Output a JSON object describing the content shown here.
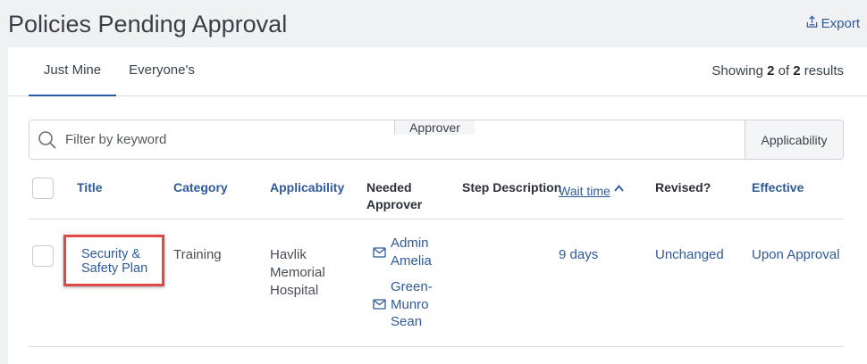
{
  "page": {
    "title": "Policies Pending Approval",
    "export_label": "Export"
  },
  "tabs": [
    {
      "label": "Just Mine",
      "active": true
    },
    {
      "label": "Everyone's",
      "active": false
    }
  ],
  "results": {
    "prefix": "Showing ",
    "shown": "2",
    "middle": " of ",
    "total": "2",
    "suffix": " results"
  },
  "filter": {
    "placeholder": "Filter by keyword",
    "value": "",
    "approver_label": "Approver",
    "applicability_label": "Applicability"
  },
  "columns": {
    "title": "Title",
    "category": "Category",
    "applicability": "Applicability",
    "needed_approver_1": "Needed",
    "needed_approver_2": "Approver",
    "step_description": "Step Description",
    "wait_time": "Wait time",
    "revised": "Revised?",
    "effective": "Effective"
  },
  "rows": [
    {
      "title_1": "Security &",
      "title_2": "Safety Plan",
      "category": "Training",
      "applicability_1": "Havlik",
      "applicability_2": "Memorial",
      "applicability_3": "Hospital",
      "approvers": [
        {
          "line_1": "Admin",
          "line_2": "Amelia"
        },
        {
          "line_1": "Green-",
          "line_2": "Munro",
          "line_3": "Sean"
        }
      ],
      "step_description": "",
      "wait_time": "9 days",
      "revised": "Unchanged",
      "effective": "Upon Approval"
    }
  ],
  "colors": {
    "accent": "#2f5a9a",
    "highlight": "#e24848",
    "background": "#f0f1f3"
  },
  "icons": {
    "export": "export-icon",
    "search": "search-icon",
    "mail": "mail-icon",
    "sort": "sort-asc-icon"
  }
}
